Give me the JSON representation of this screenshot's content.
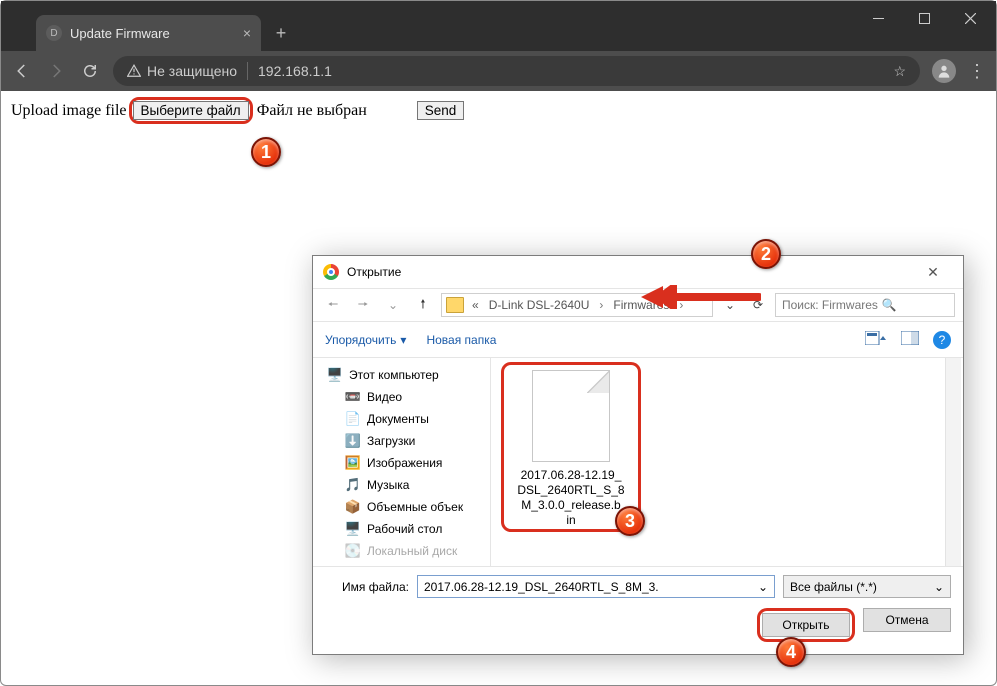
{
  "browser": {
    "tab_title": "Update Firmware",
    "security_label": "Не защищено",
    "url": "192.168.1.1"
  },
  "page": {
    "upload_label": "Upload image file",
    "choose_button": "Выберите файл",
    "no_file": "Файл не выбран",
    "send_button": "Send"
  },
  "dialog": {
    "title": "Открытие",
    "breadcrumb_prefix": "«",
    "breadcrumb_parent": "D-Link DSL-2640U",
    "breadcrumb_current": "Firmwares",
    "search_placeholder": "Поиск: Firmwares",
    "organize": "Упорядочить",
    "new_folder": "Новая папка",
    "tree": {
      "this_pc": "Этот компьютер",
      "videos": "Видео",
      "documents": "Документы",
      "downloads": "Загрузки",
      "pictures": "Изображения",
      "music": "Музыка",
      "objects3d": "Объемные объек",
      "desktop": "Рабочий стол",
      "localdisk": "Локальный диск"
    },
    "file_name": "2017.06.28-12.19_DSL_2640RTL_S_8M_3.0.0_release.bin",
    "file_name_display": "2017.06.28-12.19_\nDSL_2640RTL_S_8\nM_3.0.0_release.b\nin",
    "filename_label": "Имя файла:",
    "filename_value": "2017.06.28-12.19_DSL_2640RTL_S_8M_3.",
    "filter": "Все файлы (*.*)",
    "open": "Открыть",
    "cancel": "Отмена"
  },
  "markers": {
    "m1": "1",
    "m2": "2",
    "m3": "3",
    "m4": "4"
  }
}
